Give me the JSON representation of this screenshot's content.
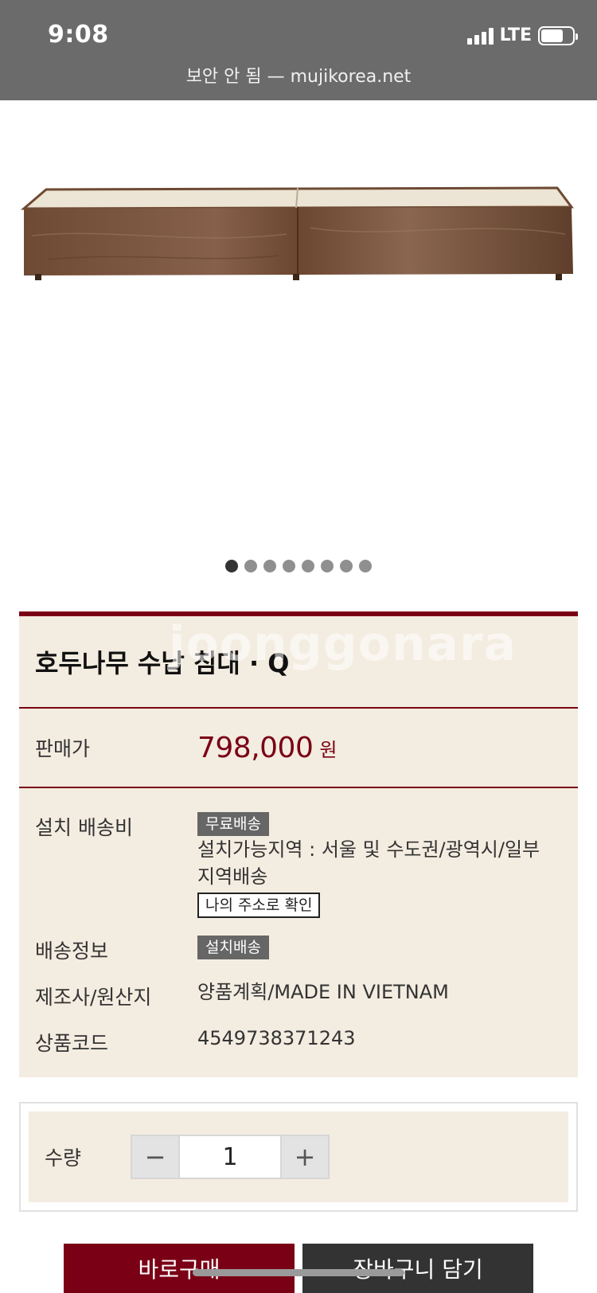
{
  "status_bar": {
    "time": "9:08",
    "network": "LTE",
    "url": "보안 안 됨 — mujikorea.net"
  },
  "gallery": {
    "total_images": 8,
    "active_index": 0
  },
  "product": {
    "title": "호두나무 수납 침대 · Q",
    "watermark": "joonggonara",
    "price_label": "판매가",
    "price": "798,000",
    "currency": "원",
    "shipping_fee_label": "설치 배송비",
    "shipping_fee_tag": "무료배송",
    "install_area": "설치가능지역 : 서울 및 수도권/광역시/일부 지역배송",
    "check_address_button": "나의 주소로 확인",
    "delivery_label": "배송정보",
    "delivery_tag": "설치배송",
    "maker_label": "제조사/원산지",
    "maker": "양품계획/MADE IN VIETNAM",
    "code_label": "상품코드",
    "code": "4549738371243"
  },
  "quantity": {
    "label": "수량",
    "value": "1",
    "minus": "−",
    "plus": "+"
  },
  "actions": {
    "buy_now": "바로구매",
    "add_to_cart": "장바구니 담기"
  },
  "colors": {
    "accent": "#7a0015",
    "panel": "#f3ece0"
  }
}
